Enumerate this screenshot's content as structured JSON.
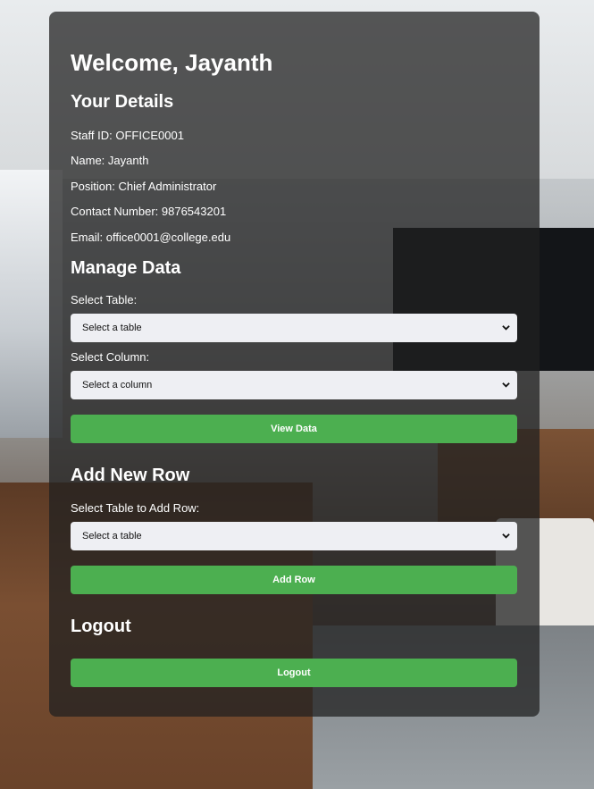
{
  "welcome_title": "Welcome, Jayanth",
  "details": {
    "heading": "Your Details",
    "staff_id": "Staff ID: OFFICE0001",
    "name": "Name: Jayanth",
    "position": "Position: Chief Administrator",
    "contact": "Contact Number: 9876543201",
    "email": "Email: office0001@college.edu"
  },
  "manage": {
    "heading": "Manage Data",
    "table_label": "Select Table:",
    "table_value": "Select a table",
    "column_label": "Select Column:",
    "column_value": "Select a column",
    "view_button": "View Data"
  },
  "add_row": {
    "heading": "Add New Row",
    "table_label": "Select Table to Add Row:",
    "table_value": "Select a table",
    "add_button": "Add Row"
  },
  "logout": {
    "heading": "Logout",
    "button": "Logout"
  },
  "colors": {
    "panel_bg": "rgba(32,32,32,0.74)",
    "button_green": "#4caf50",
    "select_bg": "#eeeff3"
  }
}
